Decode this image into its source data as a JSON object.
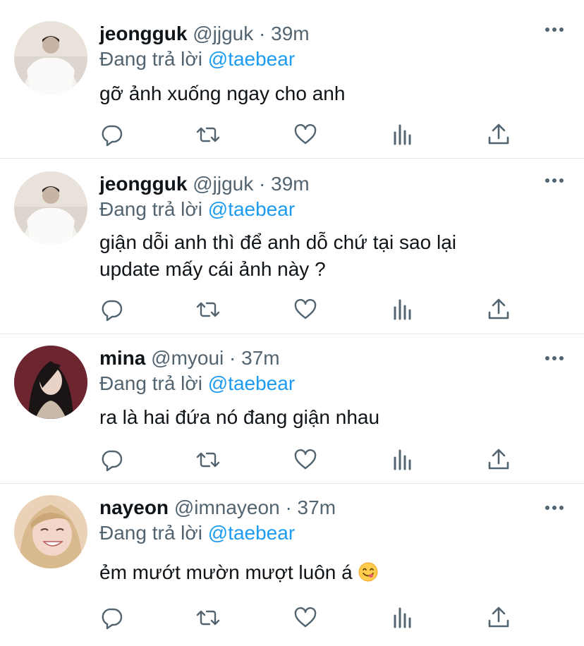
{
  "tweets": [
    {
      "name": "jeongguk",
      "handle": "@jjguk",
      "dot": "·",
      "time": "39m",
      "reply_prefix": "Đang trả lời",
      "reply_to": "@taebear",
      "text": "gỡ ảnh xuống ngay cho anh",
      "avatar_icon": "photo-avatar-white-outfit"
    },
    {
      "name": "jeongguk",
      "handle": "@jjguk",
      "dot": "·",
      "time": "39m",
      "reply_prefix": "Đang trả lời",
      "reply_to": "@taebear",
      "text_line1": "giận dỗi anh thì để anh dỗ chứ tại sao lại",
      "text_line2": "update mấy cái ảnh này ?",
      "avatar_icon": "photo-avatar-white-outfit"
    },
    {
      "name": "mina",
      "handle": "@myoui",
      "dot": "·",
      "time": "37m",
      "reply_prefix": "Đang trả lời",
      "reply_to": "@taebear",
      "text": "ra là hai đứa nó đang giận nhau",
      "avatar_icon": "photo-avatar-dark-hair"
    },
    {
      "name": "nayeon",
      "handle": "@imnayeon",
      "dot": "·",
      "time": "37m",
      "reply_prefix": "Đang trả lời",
      "reply_to": "@taebear",
      "text": "ẻm mướt mườn mượt luôn á",
      "emoji": "yum-face-emoji",
      "avatar_icon": "photo-avatar-blonde-smile"
    }
  ],
  "action_icons": [
    "reply-icon",
    "retweet-icon",
    "like-icon",
    "analytics-icon",
    "share-icon"
  ],
  "colors": {
    "text": "#0f1419",
    "secondary": "#536471",
    "mention": "#1d9bf0",
    "divider": "#e6e6e6"
  }
}
